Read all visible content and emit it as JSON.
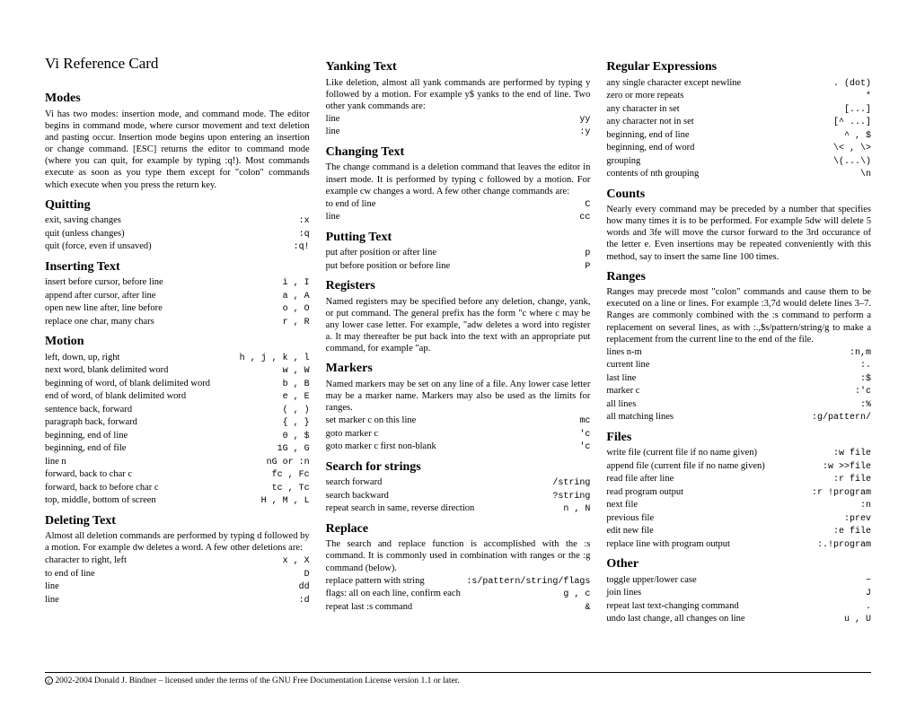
{
  "title": "Vi Reference Card",
  "col1": {
    "modes": {
      "h": "Modes",
      "p": "Vi has two modes: insertion mode, and command mode. The editor begins in command mode, where cursor movement and text deletion and pasting occur. Insertion mode begins upon entering an insertion or change command. [ESC] returns the editor to command mode (where you can quit, for example by typing :q!). Most commands execute as soon as you type them except for \"colon\" commands which execute when you press the return key."
    },
    "quitting": {
      "h": "Quitting",
      "items": [
        {
          "k": "exit, saving changes",
          "v": ":x"
        },
        {
          "k": "quit (unless changes)",
          "v": ":q"
        },
        {
          "k": "quit (force, even if unsaved)",
          "v": ":q!"
        }
      ]
    },
    "inserting": {
      "h": "Inserting Text",
      "items": [
        {
          "k": "insert before cursor, before line",
          "v": "i , I"
        },
        {
          "k": "append after cursor, after line",
          "v": "a , A"
        },
        {
          "k": "open new line after, line before",
          "v": "o , O"
        },
        {
          "k": "replace one char, many chars",
          "v": "r , R"
        }
      ]
    },
    "motion": {
      "h": "Motion",
      "items": [
        {
          "k": "left, down, up, right",
          "v": "h , j , k , l"
        },
        {
          "k": "next word, blank delimited word",
          "v": "w , W"
        },
        {
          "k": "beginning of word, of blank delimited word",
          "v": "b , B"
        },
        {
          "k": "end of word, of blank delimited word",
          "v": "e , E"
        },
        {
          "k": "sentence back, forward",
          "v": "( , )"
        },
        {
          "k": "paragraph back, forward",
          "v": "{ , }"
        },
        {
          "k": "beginning, end of line",
          "v": "0 , $"
        },
        {
          "k": "beginning, end of file",
          "v": "1G , G"
        },
        {
          "k": "line n",
          "v": "nG or :n"
        },
        {
          "k": "forward, back to char c",
          "v": "fc , Fc"
        },
        {
          "k": "forward, back to before char c",
          "v": "tc , Tc"
        },
        {
          "k": "top, middle, bottom of screen",
          "v": "H , M , L"
        }
      ]
    },
    "deleting": {
      "h": "Deleting Text",
      "p": "Almost all deletion commands are performed by typing d followed by a motion. For example dw deletes a word. A few other deletions are:",
      "items": [
        {
          "k": "character to right, left",
          "v": "x , X"
        },
        {
          "k": "to end of line",
          "v": "D"
        },
        {
          "k": "line",
          "v": "dd"
        },
        {
          "k": "line",
          "v": ":d"
        }
      ]
    }
  },
  "col2": {
    "yanking": {
      "h": "Yanking Text",
      "p": "Like deletion, almost all yank commands are performed by typing y followed by a motion. For example y$ yanks to the end of line. Two other yank commands are:",
      "items": [
        {
          "k": "line",
          "v": "yy"
        },
        {
          "k": "line",
          "v": ":y"
        }
      ]
    },
    "changing": {
      "h": "Changing Text",
      "p": "The change command is a deletion command that leaves the editor in insert mode. It is performed by typing c followed by a motion. For example cw changes a word. A few other change commands are:",
      "items": [
        {
          "k": "to end of line",
          "v": "C"
        },
        {
          "k": "line",
          "v": "cc"
        }
      ]
    },
    "putting": {
      "h": "Putting Text",
      "items": [
        {
          "k": "put after position or after line",
          "v": "p"
        },
        {
          "k": "put before position or before line",
          "v": "P"
        }
      ]
    },
    "registers": {
      "h": "Registers",
      "p": "Named registers may be specified before any deletion, change, yank, or put command. The general prefix has the form \"c where c may be any lower case letter. For example, \"adw deletes a word into register a. It may thereafter be put back into the text with an appropriate put command, for example \"ap."
    },
    "markers": {
      "h": "Markers",
      "p": "Named markers may be set on any line of a file. Any lower case letter may be a marker name. Markers may also be used as the limits for ranges.",
      "items": [
        {
          "k": "set marker c on this line",
          "v": "mc"
        },
        {
          "k": "goto marker c",
          "v": "'c"
        },
        {
          "k": "goto marker c first non-blank",
          "v": "'c"
        }
      ]
    },
    "search": {
      "h": "Search for strings",
      "items": [
        {
          "k": "search forward",
          "v": "/string"
        },
        {
          "k": "search backward",
          "v": "?string"
        },
        {
          "k": "repeat search in same, reverse direction",
          "v": "n , N"
        }
      ]
    },
    "replace": {
      "h": "Replace",
      "p": "The search and replace function is accomplished with the :s command. It is commonly used in combination with ranges or the :g command (below).",
      "items": [
        {
          "k": "replace pattern with string",
          "v": ":s/pattern/string/flags"
        },
        {
          "k": "flags: all on each line, confirm each",
          "v": "g , c"
        },
        {
          "k": "repeat last :s command",
          "v": "&"
        }
      ]
    }
  },
  "col3": {
    "regex": {
      "h": "Regular Expressions",
      "items": [
        {
          "k": "any single character except newline",
          "v": ". (dot)"
        },
        {
          "k": "zero or more repeats",
          "v": "*"
        },
        {
          "k": "any character in set",
          "v": "[...]"
        },
        {
          "k": "any character not in set",
          "v": "[^ ...]"
        },
        {
          "k": "beginning, end of line",
          "v": "^ , $"
        },
        {
          "k": "beginning, end of word",
          "v": "\\< , \\>"
        },
        {
          "k": "grouping",
          "v": "\\(...\\)"
        },
        {
          "k": "contents of nth grouping",
          "v": "\\n"
        }
      ]
    },
    "counts": {
      "h": "Counts",
      "p": "Nearly every command may be preceded by a number that specifies how many times it is to be performed. For example 5dw will delete 5 words and 3fe will move the cursor forward to the 3rd occurance of the letter e. Even insertions may be repeated conveniently with this method, say to insert the same line 100 times."
    },
    "ranges": {
      "h": "Ranges",
      "p": "Ranges may precede most \"colon\" commands and cause them to be executed on a line or lines. For example :3,7d would delete lines 3–7. Ranges are commonly combined with the :s command to perform a replacement on several lines, as with :.,$s/pattern/string/g to make a replacement from the current line to the end of the file.",
      "items": [
        {
          "k": "lines n-m",
          "v": ":n,m"
        },
        {
          "k": "current line",
          "v": ":."
        },
        {
          "k": "last line",
          "v": ":$"
        },
        {
          "k": "marker c",
          "v": ":'c"
        },
        {
          "k": "all lines",
          "v": ":%"
        },
        {
          "k": "all matching lines",
          "v": ":g/pattern/"
        }
      ]
    },
    "files": {
      "h": "Files",
      "items": [
        {
          "k": "write file (current file if no name given)",
          "v": ":w file"
        },
        {
          "k": "append file (current file if no name given)",
          "v": ":w >>file"
        },
        {
          "k": "read file after line",
          "v": ":r file"
        },
        {
          "k": "read program output",
          "v": ":r !program"
        },
        {
          "k": "next file",
          "v": ":n"
        },
        {
          "k": "previous file",
          "v": ":prev"
        },
        {
          "k": "edit new file",
          "v": ":e file"
        },
        {
          "k": "replace line with program output",
          "v": ":.!program"
        }
      ]
    },
    "other": {
      "h": "Other",
      "items": [
        {
          "k": "toggle upper/lower case",
          "v": "~"
        },
        {
          "k": "join lines",
          "v": "J"
        },
        {
          "k": "repeat last text-changing command",
          "v": "."
        },
        {
          "k": "undo last change, all changes on line",
          "v": "u , U"
        }
      ]
    }
  },
  "footer": "2002-2004 Donald J. Bindner – licensed under the terms of the GNU Free Documentation License version 1.1 or later."
}
